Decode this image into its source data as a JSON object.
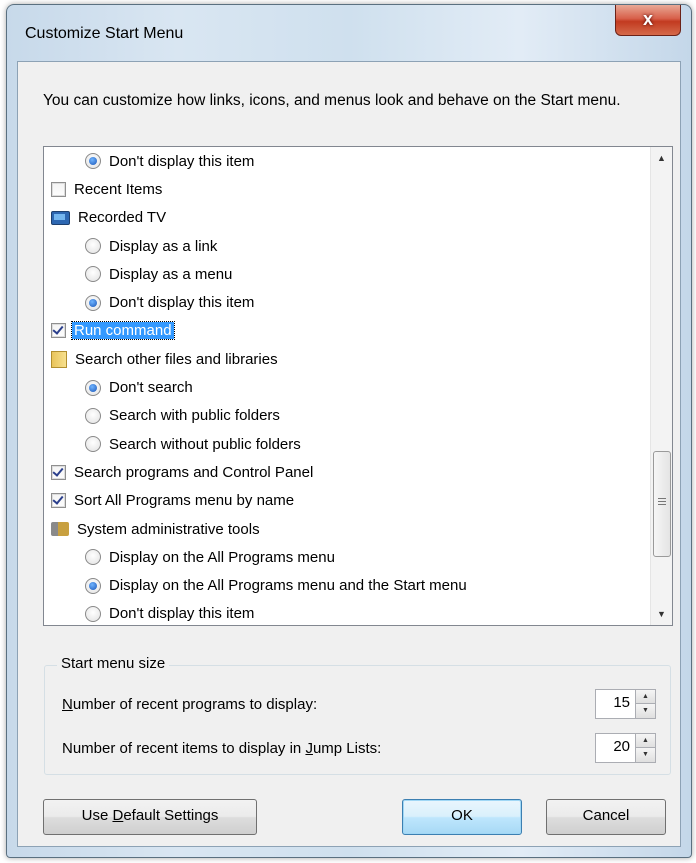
{
  "window": {
    "title": "Customize Start Menu",
    "close_glyph": "x"
  },
  "description": "You can customize how links, icons, and menus look and behave on the Start menu.",
  "options": [
    {
      "level": 1,
      "control": "radio",
      "checked": true,
      "label": "Don't display this item"
    },
    {
      "level": 0,
      "control": "checkbox",
      "checked": false,
      "label": "Recent Items"
    },
    {
      "level": 0,
      "control": "icon",
      "icon": "recorded-tv-icon",
      "label": "Recorded TV"
    },
    {
      "level": 1,
      "control": "radio",
      "checked": false,
      "label": "Display as a link"
    },
    {
      "level": 1,
      "control": "radio",
      "checked": false,
      "label": "Display as a menu"
    },
    {
      "level": 1,
      "control": "radio",
      "checked": true,
      "label": "Don't display this item"
    },
    {
      "level": 0,
      "control": "checkbox",
      "checked": true,
      "label": "Run command",
      "selected": true
    },
    {
      "level": 0,
      "control": "icon",
      "icon": "folder-icon",
      "label": "Search other files and libraries"
    },
    {
      "level": 1,
      "control": "radio",
      "checked": true,
      "label": "Don't search"
    },
    {
      "level": 1,
      "control": "radio",
      "checked": false,
      "label": "Search with public folders"
    },
    {
      "level": 1,
      "control": "radio",
      "checked": false,
      "label": "Search without public folders"
    },
    {
      "level": 0,
      "control": "checkbox",
      "checked": true,
      "label": "Search programs and Control Panel"
    },
    {
      "level": 0,
      "control": "checkbox",
      "checked": true,
      "label": "Sort All Programs menu by name"
    },
    {
      "level": 0,
      "control": "icon",
      "icon": "admin-tools-icon",
      "label": "System administrative tools"
    },
    {
      "level": 1,
      "control": "radio",
      "checked": false,
      "label": "Display on the All Programs menu"
    },
    {
      "level": 1,
      "control": "radio",
      "checked": true,
      "label": "Display on the All Programs menu and the Start menu"
    },
    {
      "level": 1,
      "control": "radio",
      "checked": false,
      "label": "Don't display this item"
    }
  ],
  "scrollbar": {
    "up_glyph": "▲",
    "down_glyph": "▼",
    "position_fraction": 0.78
  },
  "start_menu_size": {
    "legend": "Start menu size",
    "recent_programs": {
      "label_pre": "",
      "label_mnemonic": "N",
      "label_post": "umber of recent programs to display:",
      "value": "15"
    },
    "recent_items": {
      "label_pre": "Number of recent items to display in ",
      "label_mnemonic": "J",
      "label_post": "ump Lists:",
      "value": "20"
    },
    "spin_up_glyph": "▲",
    "spin_down_glyph": "▼"
  },
  "buttons": {
    "defaults_pre": "Use ",
    "defaults_mnemonic": "D",
    "defaults_post": "efault Settings",
    "ok": "OK",
    "cancel": "Cancel"
  }
}
